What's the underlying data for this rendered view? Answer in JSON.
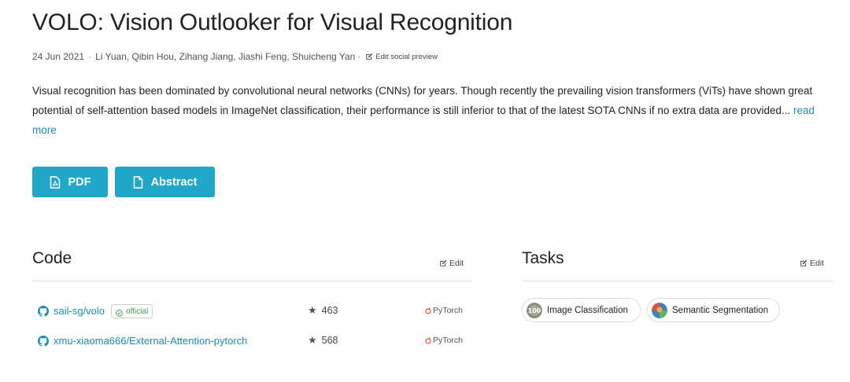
{
  "paper": {
    "title": "VOLO: Vision Outlooker for Visual Recognition",
    "date": "24 Jun 2021",
    "separator": "·",
    "authors": "Li Yuan, Qibin Hou, Zihang Jiang, Jiashi Feng, Shuicheng Yan",
    "edit_social_preview": "Edit social preview",
    "abstract": "Visual recognition has been dominated by convolutional neural networks (CNNs) for years. Though recently the prevailing vision transformers (ViTs) have shown great potential of self-attention based models in ImageNet classification, their performance is still inferior to that of the latest SOTA CNNs if no extra data are provided...",
    "read_more": "read more"
  },
  "buttons": {
    "pdf": "PDF",
    "abstract": "Abstract"
  },
  "code": {
    "heading": "Code",
    "edit": "Edit",
    "repos": [
      {
        "name": "sail-sg/volo",
        "badge": "official",
        "stars": "463",
        "framework": "PyTorch"
      },
      {
        "name": "xmu-xiaoma666/External-Attention-pytorch",
        "stars": "568",
        "framework": "PyTorch"
      }
    ]
  },
  "tasks": {
    "heading": "Tasks",
    "edit": "Edit",
    "items": [
      {
        "label": "Image Classification",
        "icon": "image-classification-icon"
      },
      {
        "label": "Semantic Segmentation",
        "icon": "semantic-segmentation-icon"
      }
    ]
  },
  "colors": {
    "accent": "#21a7c7",
    "link": "#1b8db0",
    "official": "#3a9d4f",
    "pytorch": "#ee4c2c"
  }
}
